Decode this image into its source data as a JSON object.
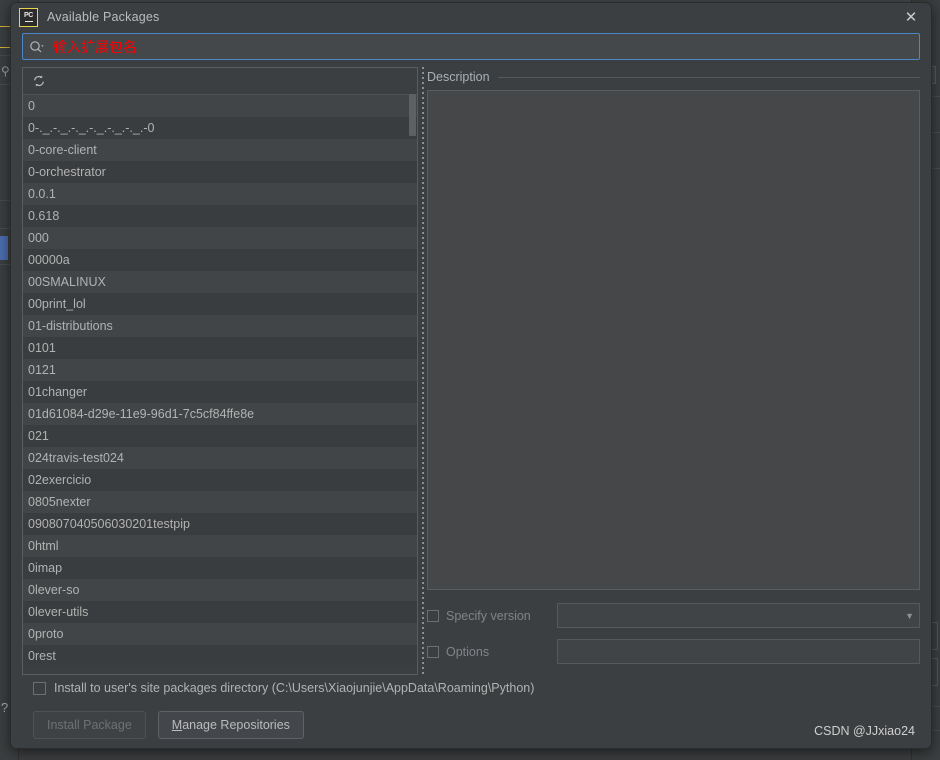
{
  "dialog": {
    "title": "Available Packages",
    "logo_text": "PC",
    "close_icon": "close-x"
  },
  "search": {
    "placeholder": "输入扩展包名",
    "value": "",
    "icon": "search-icon-with-dropdown"
  },
  "list_toolbar": {
    "refresh_icon": "refresh-icon"
  },
  "packages": [
    "0",
    "0-._.-._.-._.-._.-._.-._.-0",
    "0-core-client",
    "0-orchestrator",
    "0.0.1",
    "0.618",
    "000",
    "00000a",
    "00SMALINUX",
    "00print_lol",
    "01-distributions",
    "0101",
    "0121",
    "01changer",
    "01d61084-d29e-11e9-96d1-7c5cf84ffe8e",
    "021",
    "024travis-test024",
    "02exercicio",
    "0805nexter",
    "090807040506030201testpip",
    "0html",
    "0imap",
    "0lever-so",
    "0lever-utils",
    "0proto",
    "0rest"
  ],
  "description": {
    "title": "Description",
    "body": ""
  },
  "options": {
    "specify_version": {
      "label": "Specify version",
      "checked": false,
      "value": "",
      "dropdown_icon": "chevron-down-icon"
    },
    "options_field": {
      "label": "Options",
      "checked": false,
      "value": ""
    }
  },
  "install_user": {
    "label": "Install to user's site packages directory (C:\\Users\\Xiaojunjie\\AppData\\Roaming\\Python)",
    "checked": false
  },
  "buttons": {
    "install": {
      "label": "Install Package",
      "enabled": false
    },
    "manage": {
      "mnemonic": "M",
      "rest": "anage Repositories"
    }
  },
  "watermark": "CSDN @JJxiao24",
  "backdrop": {
    "help_icon": "question-mark-icon",
    "search_icon": "search-icon",
    "close_icon": "close-x",
    "arrow_icon": "arrow-right-icon",
    "chip_label": "⋮"
  },
  "colors": {
    "accent_focus": "#4a88c7",
    "placeholder_red": "#ff0000",
    "logo_yellow": "#e8d44d",
    "panel_bg": "#3c3f41",
    "row_odd": "#414547",
    "row_even": "#3a3d3f",
    "selection_blue": "#4b6eaf"
  }
}
